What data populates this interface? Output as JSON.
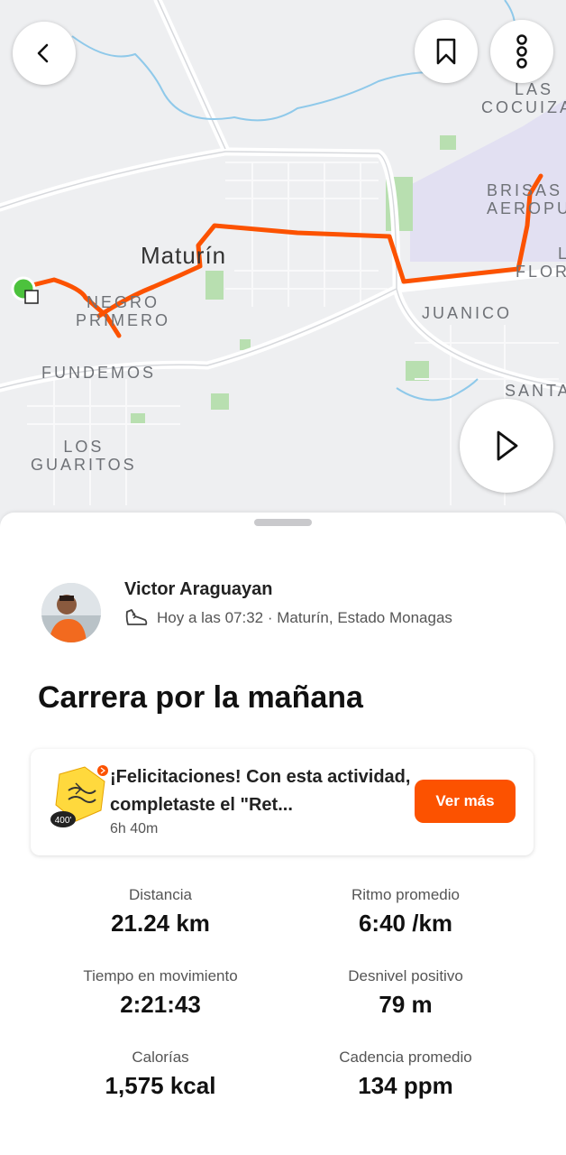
{
  "map": {
    "labels": {
      "city": "Maturín",
      "las_cocuizas": "LAS\nCOCUIZAS",
      "brisas": "BRISAS\nAEROPU",
      "flor": "L\nFLOR",
      "juanico": "JUANICO",
      "negro_primero": "NEGRO\nPRIMERO",
      "fundemos": "FUNDEMOS",
      "los_guaritos": "LOS\nGUARITOS",
      "santa": "SANTA"
    },
    "route_color": "#fc5200",
    "start_color": "#4cc23d"
  },
  "top_bar": {
    "back_icon": "chevron-left-icon",
    "bookmark_icon": "bookmark-icon",
    "more_icon": "vertical-dots-icon",
    "play_icon": "play-icon"
  },
  "activity": {
    "athlete": "Victor Araguayan",
    "meta": "Hoy a las 07:32 · Maturín, Estado Monagas",
    "title": "Carrera por la mañana"
  },
  "challenge_card": {
    "text": "¡Felicitaciones! Con esta actividad, completaste el \"Ret...",
    "subtext": "6h 40m",
    "button": "Ver más",
    "badge_number": "400'"
  },
  "stats": [
    {
      "label": "Distancia",
      "value": "21.24 km"
    },
    {
      "label": "Ritmo promedio",
      "value": "6:40 /km"
    },
    {
      "label": "Tiempo en movimiento",
      "value": "2:21:43"
    },
    {
      "label": "Desnivel positivo",
      "value": "79 m"
    },
    {
      "label": "Calorías",
      "value": "1,575 kcal"
    },
    {
      "label": "Cadencia promedio",
      "value": "134 ppm"
    }
  ]
}
